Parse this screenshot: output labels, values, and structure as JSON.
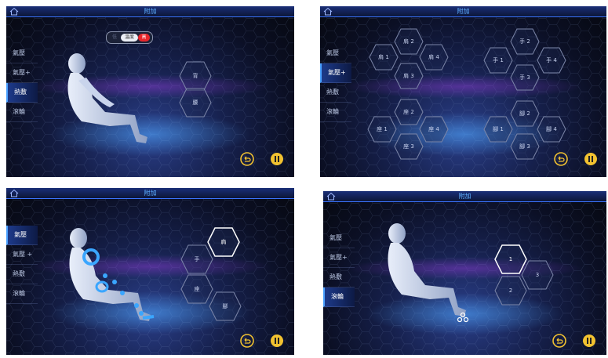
{
  "panel1": {
    "title": "附加",
    "menu": [
      "氣壓",
      "氣壓+",
      "熱敷",
      "滾輪"
    ],
    "active": 2,
    "toggle": {
      "label": "溫度",
      "value": "高"
    },
    "hexes": [
      "背",
      "腰"
    ]
  },
  "panel2": {
    "title": "附加",
    "menu": [
      "氣壓",
      "氣壓+",
      "熱敷",
      "滾輪"
    ],
    "active": 1,
    "shoulder": [
      "肩 2",
      "肩 1",
      "肩 4",
      "肩 3"
    ],
    "hand": [
      "手 2",
      "手 1",
      "手 4",
      "手 3"
    ],
    "seat": [
      "座 2",
      "座 1",
      "座 4",
      "座 3"
    ],
    "knee": [
      "腳 2",
      "腳 1",
      "腳 4",
      "腳 3"
    ]
  },
  "panel3": {
    "title": "附加",
    "menu": [
      "氣壓",
      "氣壓 +",
      "熱敷",
      "滾輪"
    ],
    "active": 0,
    "hexes": [
      "肩",
      "手",
      "座",
      "腳"
    ]
  },
  "panel4": {
    "title": "附加",
    "menu": [
      "氣壓",
      "氣壓+",
      "熱敷",
      "滾輪"
    ],
    "active": 3,
    "hexes": [
      "1",
      "3",
      "2"
    ]
  },
  "icons": {
    "home": "home-icon",
    "back": "back-icon",
    "pause": "pause-icon"
  },
  "colors": {
    "accent": "#f2c230",
    "active_hex": "#ffffff",
    "toggle_on": "#e8262c",
    "title": "#5fb0ff"
  }
}
